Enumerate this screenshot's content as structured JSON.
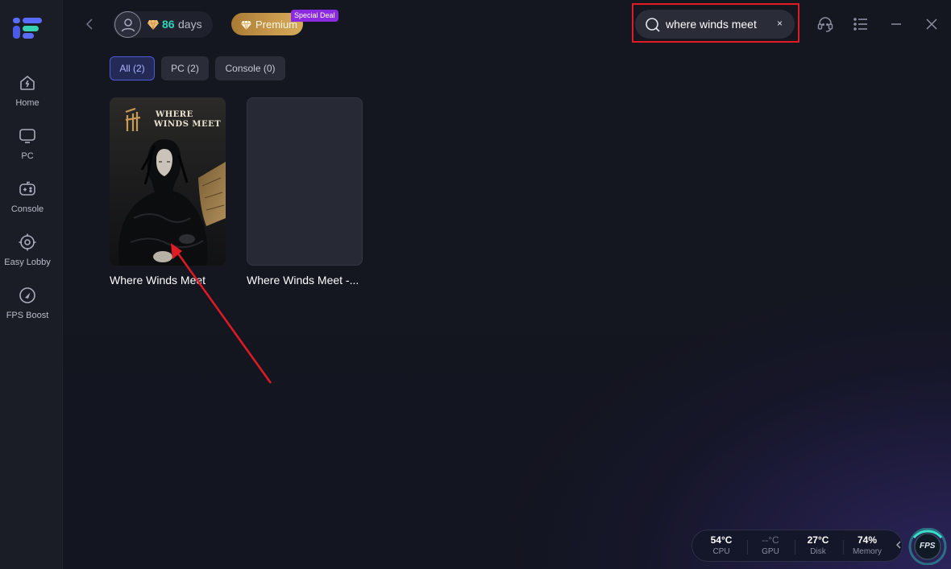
{
  "sidebar": {
    "items": [
      {
        "label": "Home",
        "icon": "home-icon"
      },
      {
        "label": "PC",
        "icon": "monitor-icon"
      },
      {
        "label": "Console",
        "icon": "gamepad-icon"
      },
      {
        "label": "Easy Lobby",
        "icon": "crosshair-icon"
      },
      {
        "label": "FPS Boost",
        "icon": "speedometer-icon"
      }
    ]
  },
  "header": {
    "days_count": "86",
    "days_label": "days",
    "premium_label": "Premium",
    "deal_badge": "Special Deal",
    "search_value": "where winds meet",
    "search_clear": "×"
  },
  "tabs": [
    {
      "label": "All (2)",
      "active": true
    },
    {
      "label": "PC (2)",
      "active": false
    },
    {
      "label": "Console (0)",
      "active": false
    }
  ],
  "games": [
    {
      "title": "Where Winds Meet",
      "cover_text_line1": "WHERE",
      "cover_text_line2": "WINDS MEET"
    },
    {
      "title": "Where Winds Meet -..."
    }
  ],
  "status": {
    "cpu_value": "54°C",
    "cpu_label": "CPU",
    "gpu_value": "--°C",
    "gpu_label": "GPU",
    "disk_value": "27°C",
    "disk_label": "Disk",
    "memory_value": "74%",
    "memory_label": "Memory",
    "fps_label": "FPS"
  },
  "colors": {
    "accent_teal": "#32d2b8",
    "accent_blue": "#4e5bd6",
    "premium_gold": "#c99a4c",
    "deal_purple": "#8a2be2",
    "highlight_red": "#e01b24"
  }
}
